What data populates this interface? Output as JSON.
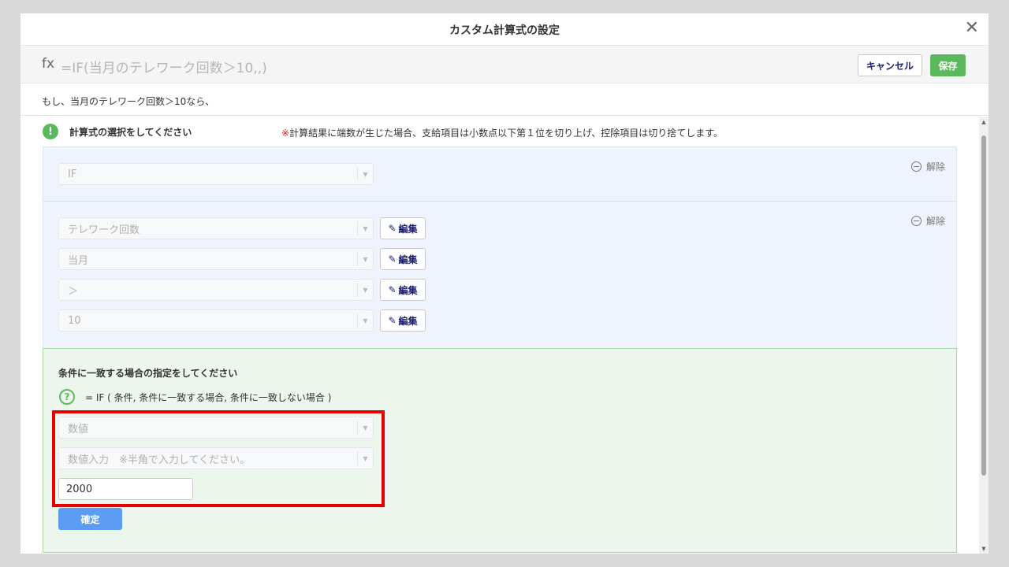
{
  "modal": {
    "title": "カスタム計算式の設定",
    "close_symbol": "✕"
  },
  "formula_bar": {
    "fx_label": "fx",
    "formula": "=IF(当月のテレワーク回数＞10,,)",
    "cancel_label": "キャンセル",
    "save_label": "保存"
  },
  "description": "もし、当月のテレワーク回数＞10なら、",
  "selection": {
    "heading": "計算式の選択をしてください",
    "note_mark": "※",
    "note_text": "計算結果に端数が生じた場合、支給項目は小数点以下第１位を切り上げ、控除項目は切り捨てします。"
  },
  "panel_a": {
    "function_value": "IF",
    "release_label": "解除"
  },
  "panel_b": {
    "release_label": "解除",
    "edit_label": "編集",
    "rows": [
      "テレワーク回数",
      "当月",
      "＞",
      "10"
    ]
  },
  "condition_panel": {
    "title": "条件に一致する場合の指定をしてください",
    "help_text": "= IF ( 条件, 条件に一致する場合, 条件に一致しない場合 )",
    "type_placeholder": "数値",
    "input_mode_placeholder": "数値入力　※半角で入力してください。",
    "value": "2000",
    "confirm_label": "確定"
  },
  "colors": {
    "save_green": "#5cb85c",
    "confirm_blue": "#5b9cf4",
    "highlight_red": "#e60000",
    "panel_blue": "#eef3fd",
    "panel_green": "#ecf6ec"
  }
}
